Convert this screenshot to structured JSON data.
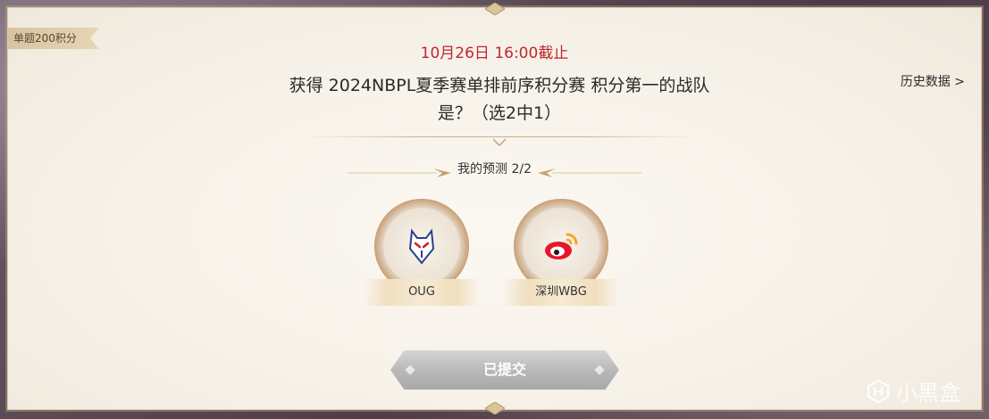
{
  "badge": {
    "points": "单题200积分"
  },
  "deadline": "10月26日 16:00截止",
  "history": {
    "label": "历史数据 >"
  },
  "question": {
    "line1": "获得 2024NBPL夏季赛单排前序积分赛 积分第一的战队",
    "line2": "是？（选2中1）"
  },
  "prediction": {
    "label": "我的预测 2/2"
  },
  "teams": [
    {
      "name": "OUG",
      "icon": "oug-logo-icon"
    },
    {
      "name": "深圳WBG",
      "icon": "weibo-logo-icon"
    }
  ],
  "submit": {
    "label": "已提交"
  },
  "watermark": {
    "label": "小黑盒"
  },
  "colors": {
    "deadline": "#c0262d",
    "accent_gold": "#c8a26a",
    "ring_red": "#9a2a22",
    "button_gray": "#b9b9b9"
  }
}
